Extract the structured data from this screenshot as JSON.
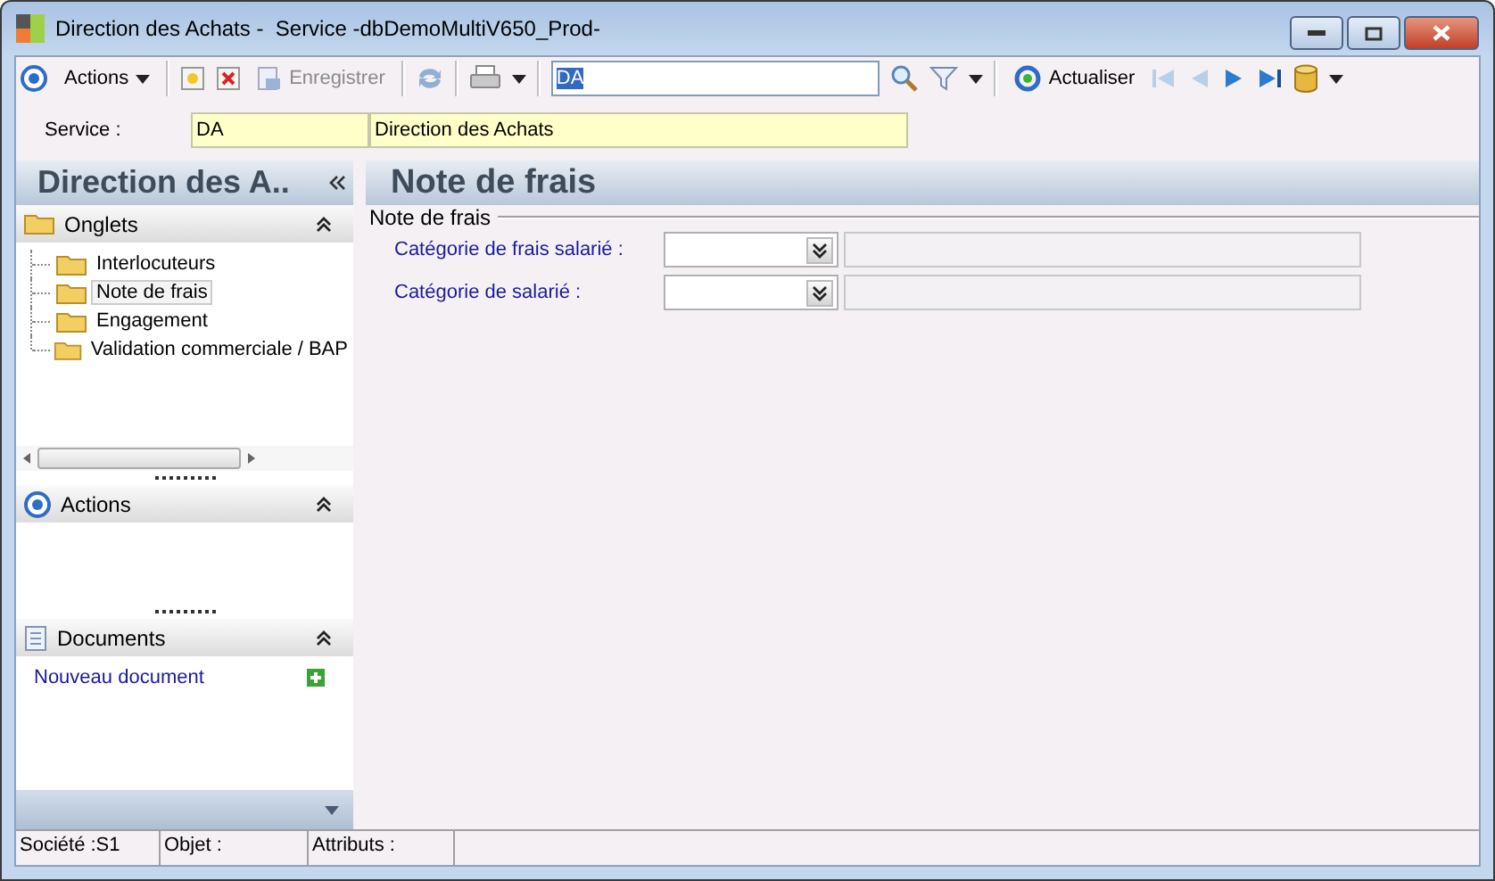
{
  "window": {
    "title": "Direction des Achats -  Service -dbDemoMultiV650_Prod-"
  },
  "toolbar": {
    "actions_label": "Actions",
    "save": {
      "label": "Enregistrer",
      "disabled": true
    },
    "search": {
      "value": "DA"
    },
    "refresh_label": "Actualiser"
  },
  "header": {
    "label": "Service :",
    "code": "DA",
    "name": "Direction des Achats"
  },
  "sidebar": {
    "title": "Direction des A..",
    "sections": [
      {
        "kind": "tree",
        "title": "Onglets",
        "expanded": true,
        "items": [
          {
            "label": "Interlocuteurs",
            "selected": false
          },
          {
            "label": "Note de frais",
            "selected": true
          },
          {
            "label": "Engagement",
            "selected": false
          },
          {
            "label": "Validation commerciale / BAP",
            "selected": false
          }
        ]
      },
      {
        "kind": "actions",
        "title": "Actions",
        "expanded": true
      },
      {
        "kind": "documents",
        "title": "Documents",
        "expanded": true,
        "link": "Nouveau document"
      }
    ]
  },
  "form": {
    "title": "Note de frais",
    "group_label": "Note de frais",
    "fields": [
      {
        "label": "Catégorie de frais salarié :"
      },
      {
        "label": "Catégorie de salarié :"
      }
    ]
  },
  "status_bar": [
    "Société :S1",
    "Objet :",
    "Attributs :"
  ]
}
